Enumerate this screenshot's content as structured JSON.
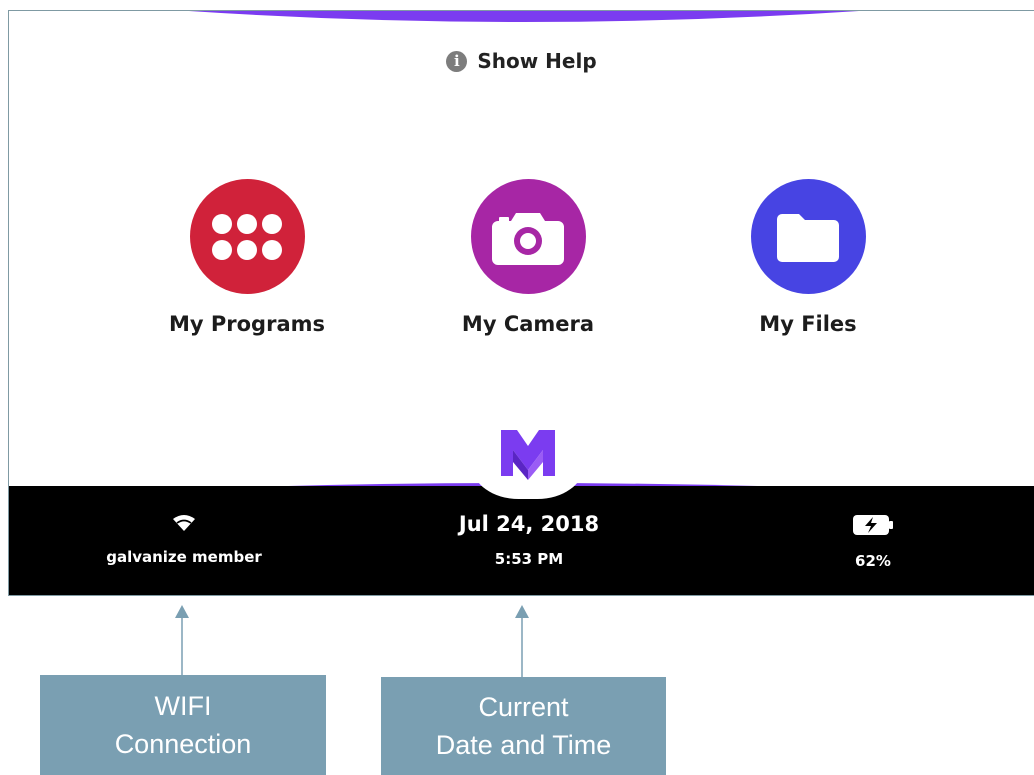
{
  "help": {
    "label": "Show Help",
    "icon": "info-icon"
  },
  "apps": [
    {
      "label": "My Programs",
      "icon": "grid-dots-icon",
      "color": "#d0223a"
    },
    {
      "label": "My Camera",
      "icon": "camera-icon",
      "color": "#a726a5"
    },
    {
      "label": "My Files",
      "icon": "folder-icon",
      "color": "#4744e3"
    }
  ],
  "status": {
    "wifi_name": "galvanize member",
    "date": "Jul 24, 2018",
    "time": "5:53 PM",
    "battery": "62%"
  },
  "annotations": {
    "wifi": [
      "WIFI",
      "Connection"
    ],
    "datetime": [
      "Current",
      "Date and Time"
    ]
  },
  "colors": {
    "accent_purple": "#7b3cf0",
    "status_bar": "#000000",
    "callout": "#7a9fb2"
  }
}
